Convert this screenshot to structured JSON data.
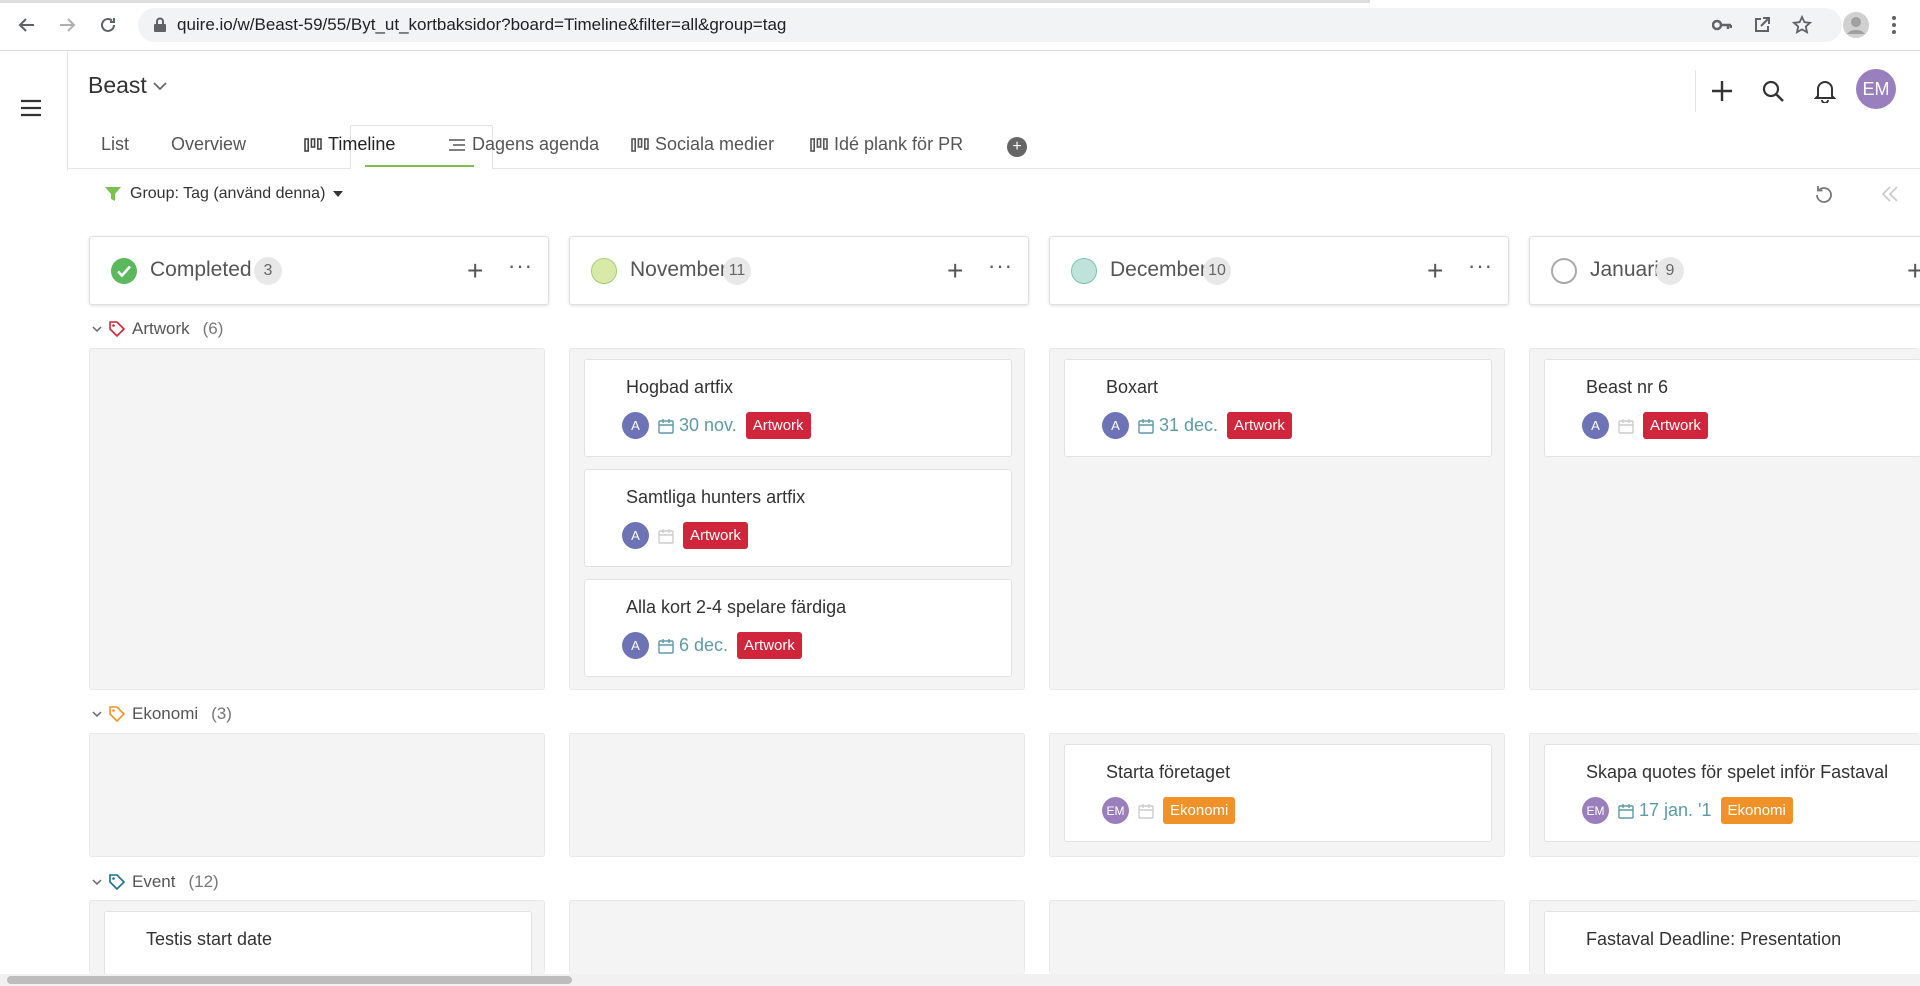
{
  "browser": {
    "url": "quire.io/w/Beast-59/55/Byt_ut_kortbaksidor?board=Timeline&filter=all&group=tag"
  },
  "app": {
    "project_title": "Beast",
    "user_initials": "EM"
  },
  "tabs": [
    {
      "label": "List",
      "icon": ""
    },
    {
      "label": "Overview",
      "icon": ""
    },
    {
      "label": "Timeline",
      "icon": "board-icon"
    },
    {
      "label": "Dagens agenda",
      "icon": "agenda-icon"
    },
    {
      "label": "Sociala medier",
      "icon": "board-icon"
    },
    {
      "label": "Idé plank för PR",
      "icon": "board-icon"
    }
  ],
  "toolbar": {
    "group_label": "Group: Tag (använd denna)"
  },
  "columns": [
    {
      "name": "Completed",
      "count": "3",
      "status": "done"
    },
    {
      "name": "November",
      "count": "11",
      "status": "light-green"
    },
    {
      "name": "December",
      "count": "10",
      "status": "teal"
    },
    {
      "name": "Januari",
      "count": "9",
      "status": "empty"
    }
  ],
  "groups": [
    {
      "name": "Artwork",
      "count": "(6)",
      "tag_color": "#d0253a",
      "cards": {
        "november": [
          {
            "title": "Hogbad artfix",
            "assignee": "A",
            "date": "30 nov.",
            "tag": "Artwork"
          },
          {
            "title": "Samtliga hunters artfix",
            "assignee": "A",
            "date": "",
            "tag": "Artwork"
          },
          {
            "title": "Alla kort 2-4 spelare färdiga",
            "assignee": "A",
            "date": "6 dec.",
            "tag": "Artwork"
          }
        ],
        "december": [
          {
            "title": "Boxart",
            "assignee": "A",
            "date": "31 dec.",
            "tag": "Artwork"
          }
        ],
        "januari": [
          {
            "title": "Beast nr 6",
            "assignee": "A",
            "date": "",
            "tag": "Artwork"
          }
        ]
      }
    },
    {
      "name": "Ekonomi",
      "count": "(3)",
      "tag_color": "#f0922a",
      "cards": {
        "december": [
          {
            "title": "Starta företaget",
            "assignee": "EM",
            "date": "",
            "tag": "Ekonomi"
          }
        ],
        "januari": [
          {
            "title": "Skapa quotes för spelet inför Fastaval",
            "assignee": "EM",
            "date": "17 jan. '1",
            "tag": "Ekonomi"
          }
        ]
      }
    },
    {
      "name": "Event",
      "count": "(12)",
      "tag_color": "#1d6e8a",
      "cards": {
        "completed": [
          {
            "title": "Testis start date"
          }
        ],
        "januari": [
          {
            "title": "Fastaval Deadline: Presentation"
          }
        ]
      }
    }
  ]
}
